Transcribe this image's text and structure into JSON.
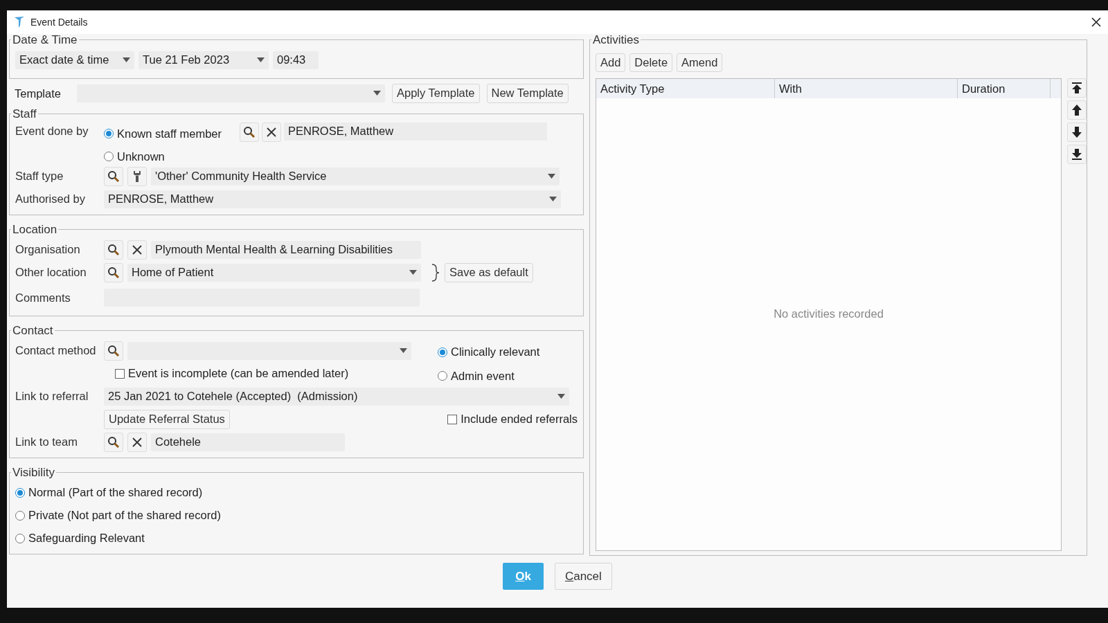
{
  "window": {
    "title": "Event Details"
  },
  "date_time": {
    "legend": "Date & Time",
    "mode": "Exact date & time",
    "date": "Tue 21 Feb 2023",
    "time": "09:43"
  },
  "template": {
    "label": "Template",
    "buttons": [
      "Apply Template",
      "New Template"
    ]
  },
  "staff": {
    "legend": "Staff",
    "event_done_by": {
      "label": "Event done by",
      "options": [
        {
          "label": "Known staff member",
          "selected": true
        },
        {
          "label": "Unknown",
          "selected": false
        }
      ],
      "value": "PENROSE, Matthew"
    },
    "staff_type": {
      "label": "Staff type",
      "value": "'Other' Community Health Service"
    },
    "authorised_by": {
      "label": "Authorised by",
      "value": "PENROSE, Matthew"
    }
  },
  "location": {
    "legend": "Location",
    "organisation": {
      "label": "Organisation",
      "value": "Plymouth Mental Health & Learning Disabilities"
    },
    "other_location": {
      "label": "Other location",
      "value": "Home of Patient"
    },
    "save_button": "Save as default",
    "comments": {
      "label": "Comments"
    }
  },
  "contact": {
    "legend": "Contact",
    "contact_method": {
      "label": "Contact method"
    },
    "relevance": [
      {
        "label": "Clinically relevant",
        "selected": true
      },
      {
        "label": "Admin event",
        "selected": false
      }
    ],
    "incomplete": {
      "label": "Event is incomplete (can be amended later)",
      "checked": false
    },
    "referral": {
      "label": "Link to referral",
      "value": "25 Jan 2021 to Cotehele (Accepted)  (Admission)"
    },
    "update_button": "Update Referral Status",
    "include_ended": {
      "label": "Include ended referrals",
      "checked": false
    },
    "team": {
      "label": "Link to team",
      "value": "Cotehele"
    }
  },
  "visibility": {
    "legend": "Visibility",
    "options": [
      {
        "label": "Normal (Part of the shared record)",
        "selected": true
      },
      {
        "label": "Private (Not part of the shared record)",
        "selected": false
      },
      {
        "label": "Safeguarding Relevant",
        "selected": false
      }
    ]
  },
  "activities": {
    "legend": "Activities",
    "buttons": [
      "Add",
      "Delete",
      "Amend"
    ],
    "columns": [
      "Activity Type",
      "With",
      "Duration"
    ],
    "empty_message": "No activities recorded"
  },
  "footer_buttons": [
    {
      "label": "Ok",
      "kind": "primary"
    },
    {
      "label": "Cancel",
      "kind": "secondary"
    }
  ]
}
